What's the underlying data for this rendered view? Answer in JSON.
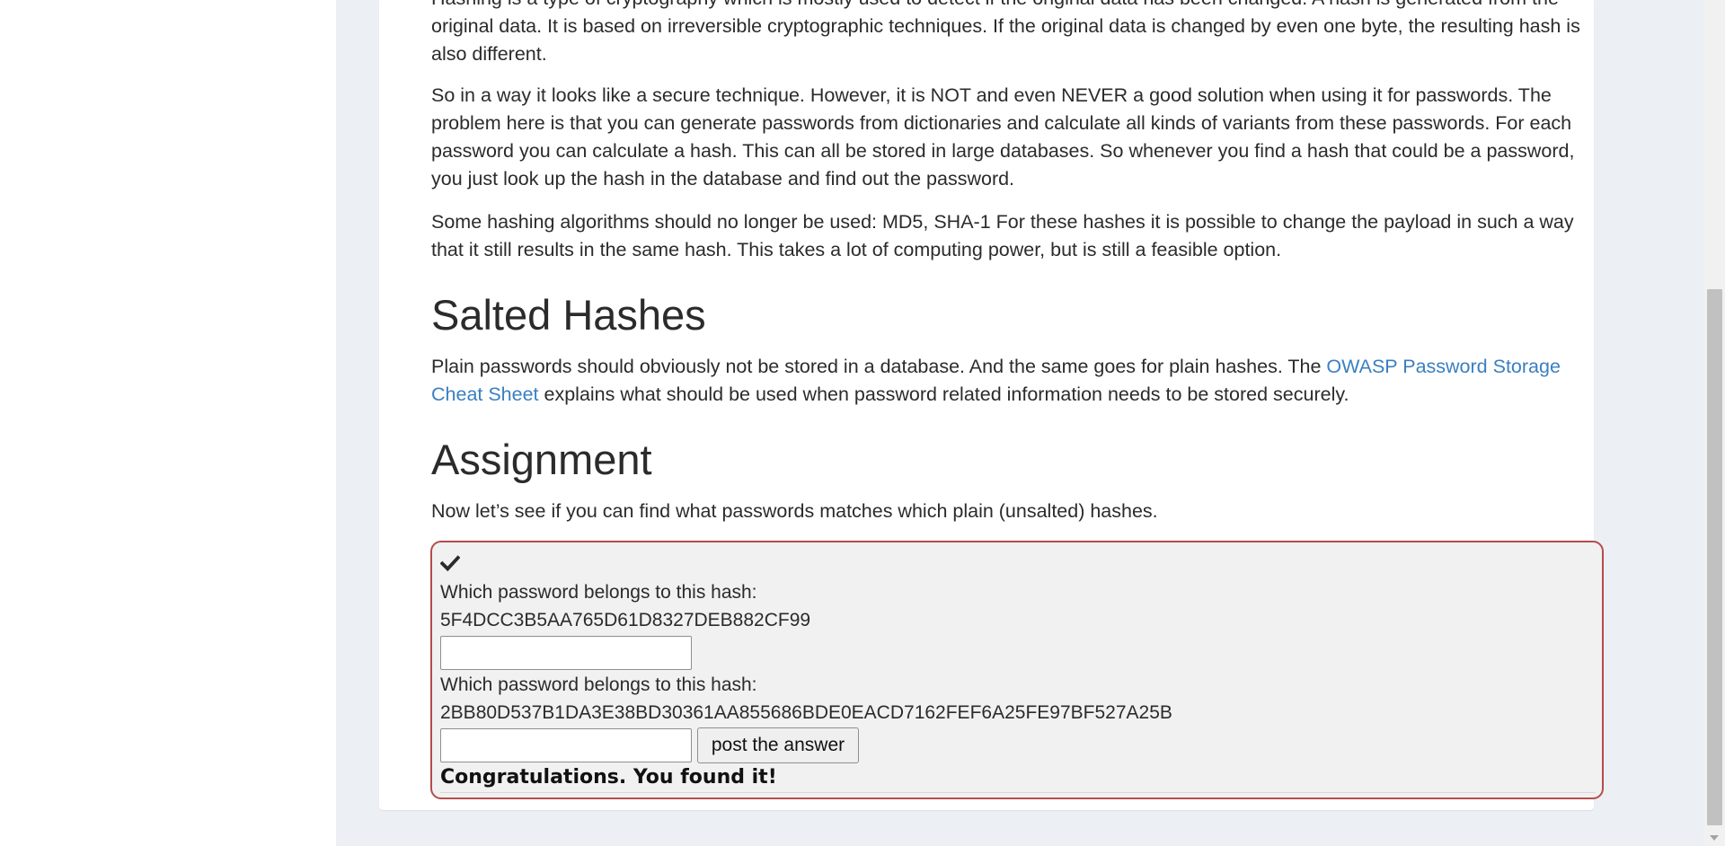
{
  "lesson": {
    "para_intro": "Hashing is a type of cryptography which is mostly used to detect if the original data has been changed. A hash is generated from the original data. It is based on irreversible cryptographic techniques. If the original data is changed by even one byte, the resulting hash is also different.",
    "para_secure": "So in a way it looks like a secure technique. However, it is NOT and even NEVER a good solution when using it for passwords. The problem here is that you can generate passwords from dictionaries and calculate all kinds of variants from these passwords. For each password you can calculate a hash. This can all be stored in large databases. So whenever you find a hash that could be a password, you just look up the hash in the database and find out the password.",
    "para_algorithms": "Some hashing algorithms should no longer be used: MD5, SHA-1 For these hashes it is possible to change the payload in such a way that it still results in the same hash. This takes a lot of computing power, but is still a feasible option.",
    "salted": {
      "heading": "Salted Hashes",
      "text_before": "Plain passwords should obviously not be stored in a database. And the same goes for plain hashes. The ",
      "link_text": "OWASP Password Storage Cheat Sheet",
      "text_after": " explains what should be used when password related information needs to be stored securely."
    },
    "assignment": {
      "heading": "Assignment",
      "text": "Now let’s see if you can find what passwords matches which plain (unsalted) hashes."
    }
  },
  "attack_form": {
    "question1_label": "Which password belongs to this hash:",
    "hash1": "5F4DCC3B5AA765D61D8327DEB882CF99",
    "answer1_value": "",
    "question2_label": "Which password belongs to this hash:",
    "hash2": "2BB80D537B1DA3E38BD30361AA855686BDE0EACD7162FEF6A25FE97BF527A25B",
    "answer2_value": "",
    "submit_label": "post the answer",
    "feedback": "Congratulations. You found it!",
    "status_icon": "check-icon"
  },
  "colors": {
    "link": "#3a7fc1",
    "attack_border": "#b44c4c",
    "page_background": "#ecf0f5"
  }
}
